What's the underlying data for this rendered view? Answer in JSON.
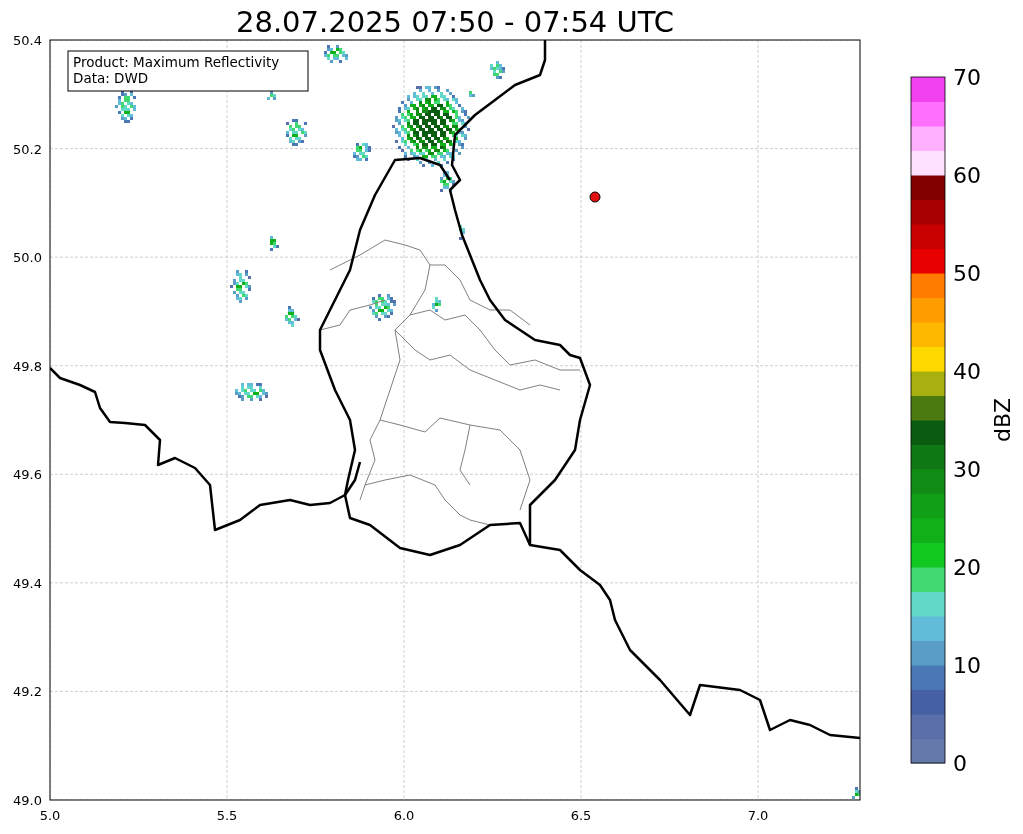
{
  "title": "28.07.2025 07:50 - 07:54 UTC",
  "legend": {
    "lines": [
      "Product: Maximum Reflectivity",
      "Data: DWD"
    ]
  },
  "map": {
    "xticks": [
      "5.0",
      "5.5",
      "6.0",
      "6.5",
      "7.0"
    ],
    "yticks": [
      "50.4",
      "50.2",
      "50.0",
      "49.8",
      "49.6",
      "49.4",
      "49.2",
      "49.0"
    ]
  },
  "colorbar": {
    "label": "dBZ",
    "ticks": [
      "70",
      "60",
      "50",
      "40",
      "30",
      "20",
      "10",
      "0"
    ],
    "segments": [
      {
        "color": "#6579aa"
      },
      {
        "color": "#5a6faa"
      },
      {
        "color": "#4560a3"
      },
      {
        "color": "#4a78b4"
      },
      {
        "color": "#5a9ec8"
      },
      {
        "color": "#60bcd8"
      },
      {
        "color": "#62d8c8"
      },
      {
        "color": "#40d870"
      },
      {
        "color": "#10c820"
      },
      {
        "color": "#10b018"
      },
      {
        "color": "#10a018"
      },
      {
        "color": "#108c14"
      },
      {
        "color": "#0e7814"
      },
      {
        "color": "#0a5c10"
      },
      {
        "color": "#4a7a10"
      },
      {
        "color": "#a8b010"
      },
      {
        "color": "#ffd800"
      },
      {
        "color": "#ffb800"
      },
      {
        "color": "#ff9c00"
      },
      {
        "color": "#ff7c00"
      },
      {
        "color": "#e80000"
      },
      {
        "color": "#c80000"
      },
      {
        "color": "#a80000"
      },
      {
        "color": "#800000"
      },
      {
        "color": "#ffe0ff"
      },
      {
        "color": "#ffb0ff"
      },
      {
        "color": "#ff70ff"
      },
      {
        "color": "#f040f0"
      }
    ]
  }
}
